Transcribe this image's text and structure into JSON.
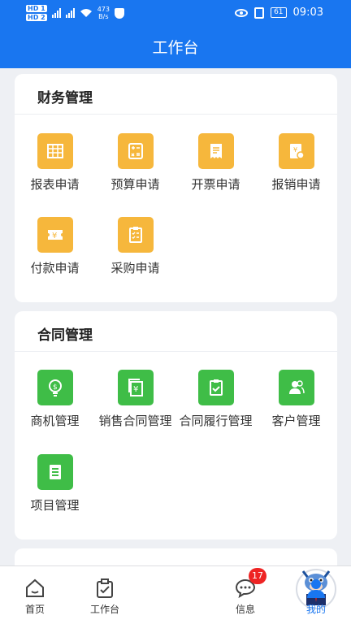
{
  "status_bar": {
    "hd1": "HD 1",
    "hd2": "HD 2",
    "net1": "4G",
    "net2": "4G",
    "speed_value": "473",
    "speed_unit": "B/s",
    "battery": "61",
    "time": "09:03"
  },
  "header": {
    "title": "工作台"
  },
  "finance": {
    "title": "财务管理",
    "items": [
      {
        "label": "报表申请",
        "icon": "table-icon"
      },
      {
        "label": "预算申请",
        "icon": "calculator-icon"
      },
      {
        "label": "开票申请",
        "icon": "receipt-icon"
      },
      {
        "label": "报销申请",
        "icon": "reimburse-icon"
      },
      {
        "label": "付款申请",
        "icon": "yen-ticket-icon"
      },
      {
        "label": "采购申请",
        "icon": "clipboard-list-icon"
      }
    ]
  },
  "contract": {
    "title": "合同管理",
    "items": [
      {
        "label": "商机管理",
        "icon": "money-bulb-icon"
      },
      {
        "label": "销售合同管理",
        "icon": "yen-document-icon"
      },
      {
        "label": "合同履行管理",
        "icon": "clipboard-check-icon"
      },
      {
        "label": "客户管理",
        "icon": "people-icon"
      },
      {
        "label": "项目管理",
        "icon": "document-list-icon"
      }
    ]
  },
  "tabbar": {
    "items": [
      {
        "label": "首页",
        "icon": "home-icon"
      },
      {
        "label": "工作台",
        "icon": "clipboard-check-icon"
      },
      {
        "label": "",
        "icon": "mascot-icon"
      },
      {
        "label": "信息",
        "icon": "chat-icon",
        "badge": "17"
      },
      {
        "label": "我的",
        "icon": "person-icon"
      }
    ],
    "active_color": "#1976f0"
  },
  "colors": {
    "primary": "#1976f0",
    "finance_icon": "#f6b73c",
    "contract_icon": "#3fbd47",
    "badge": "#ee2424"
  }
}
